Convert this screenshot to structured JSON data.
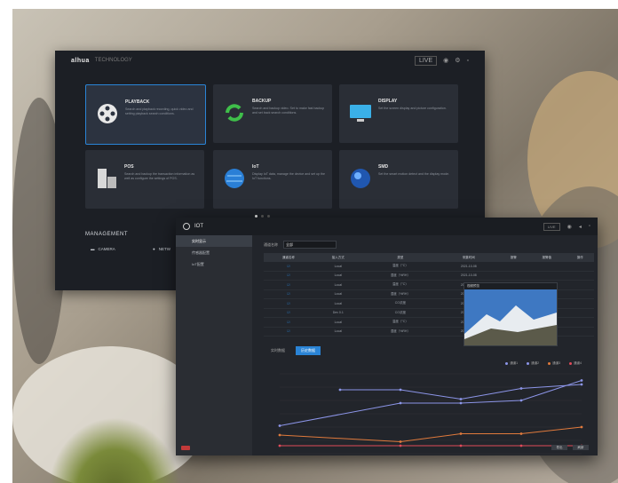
{
  "launcher": {
    "logo": "alhua",
    "subtitle": "TECHNOLOGY",
    "topbar_box": "LIVE",
    "tiles": [
      {
        "title": "PLAYBACK",
        "desc": "Search and playback recording, quick video and setting playback search conditions."
      },
      {
        "title": "BACKUP",
        "desc": "Search and backup video. Set to make fast backup and set back search conditions."
      },
      {
        "title": "DISPLAY",
        "desc": "Set the screen display and picture configuration."
      },
      {
        "title": "POS",
        "desc": "Search and backup the transaction information as well as configure the settings of POS."
      },
      {
        "title": "IoT",
        "desc": "Display IoT data, manage the device and set up the IoT functions."
      },
      {
        "title": "SMD",
        "desc": "Set the smart motion detect and the display mode."
      }
    ],
    "management_label": "MANAGEMENT",
    "management_items": [
      "CAMERA",
      "NETW"
    ]
  },
  "iot_window": {
    "title": "IOT",
    "topbar_box": "LIVE",
    "side_items": [
      "实时显示",
      "传感器配置",
      "IoT配置"
    ],
    "filter_label": "通道名称",
    "filter_value": "全部",
    "table_headers": [
      "通道名称",
      "接入方式",
      "类型",
      "采集时间",
      "报警",
      "报警值",
      "操作"
    ],
    "rows": [
      [
        "☑",
        "Local",
        "温度（°C）",
        "2021-10-08",
        "",
        "",
        ""
      ],
      [
        "☑",
        "Local",
        "湿度（%RH）",
        "2021-10-08",
        "",
        "",
        ""
      ],
      [
        "☑",
        "Local",
        "温度（°C）",
        "2021-10-08",
        "",
        "",
        ""
      ],
      [
        "☑",
        "Local",
        "湿度（%RH）",
        "2021-10-08",
        "",
        "",
        ""
      ],
      [
        "☑",
        "Local",
        "CO浓度",
        "2021-10-08",
        "",
        "",
        ""
      ],
      [
        "☑",
        "Dev 0.1",
        "CO浓度",
        "2021-10-08",
        "",
        "",
        ""
      ],
      [
        "☑",
        "Local",
        "温度（°C）",
        "2021-10-08",
        "",
        "",
        ""
      ],
      [
        "☑",
        "Local",
        "湿度（%RH）",
        "2021-10-08",
        "",
        "",
        ""
      ]
    ],
    "preview_title": "视频预览",
    "tabs": [
      "实时数据",
      "历史数据"
    ],
    "legend": [
      "通道1",
      "通道2",
      "通道3",
      "通道4"
    ],
    "buttons": [
      "导出",
      "刷新"
    ]
  },
  "chart_data": {
    "type": "line",
    "x": [
      1,
      2,
      3,
      4,
      5,
      6
    ],
    "series": [
      {
        "name": "通道1",
        "color": "#8c95e8",
        "values": [
          null,
          48,
          48,
          41,
          49,
          52
        ]
      },
      {
        "name": "通道2",
        "color": "#8c95e8",
        "values": [
          21,
          null,
          38,
          38,
          40,
          55
        ]
      },
      {
        "name": "通道3",
        "color": "#e07a3c",
        "values": [
          14,
          null,
          9,
          15,
          15,
          20
        ]
      },
      {
        "name": "通道4",
        "color": "#e04a5a",
        "values": [
          6,
          null,
          6,
          6,
          6,
          6
        ]
      }
    ],
    "ylim": [
      0,
      60
    ]
  },
  "colors": {
    "accent": "#2a84d6",
    "panel": "#1c1f25"
  }
}
